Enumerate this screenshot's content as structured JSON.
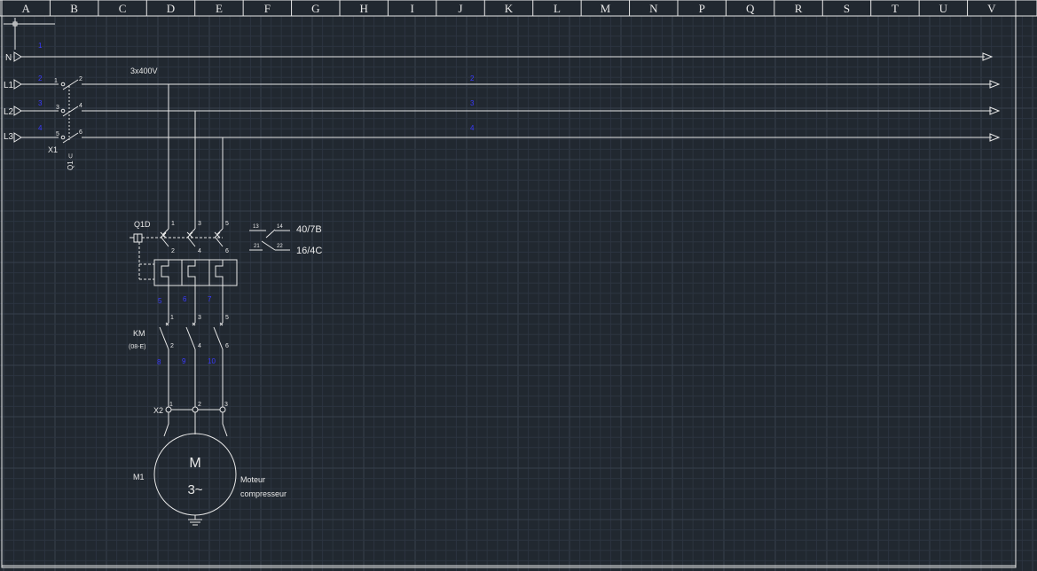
{
  "grid": {
    "columns": [
      "A",
      "B",
      "C",
      "D",
      "E",
      "F",
      "G",
      "H",
      "I",
      "J",
      "K",
      "L",
      "M",
      "N",
      "P",
      "Q",
      "R",
      "S",
      "T",
      "U",
      "V"
    ]
  },
  "colors": {
    "background": "#212830",
    "grid_minor": "#2c3440",
    "grid_major": "#36404c",
    "line": "#e8e8e8",
    "wire_number": "#3a3aff"
  },
  "supply": {
    "voltage_label": "3x400V",
    "rails": [
      {
        "label": "N",
        "num_left": "1",
        "num_mid": ""
      },
      {
        "label": "L1",
        "num_left": "2",
        "num_mid": "2"
      },
      {
        "label": "L2",
        "num_left": "3",
        "num_mid": "3"
      },
      {
        "label": "L3",
        "num_left": "4",
        "num_mid": "4"
      }
    ]
  },
  "main_switch": {
    "name": "X1",
    "label": "Q1 ⊂",
    "terminals": [
      "1",
      "2",
      "3",
      "4",
      "5",
      "6"
    ]
  },
  "breaker": {
    "name": "Q1D",
    "top_terminals": [
      "1",
      "3",
      "5"
    ],
    "bottom_terminals": [
      "2",
      "4",
      "6"
    ],
    "aux_contacts": [
      {
        "left": "13",
        "right": "14",
        "ref": "40/7B"
      },
      {
        "left": "21",
        "right": "22",
        "ref": "16/4C"
      }
    ],
    "wire_numbers": [
      "5",
      "6",
      "7"
    ]
  },
  "contactor": {
    "name": "KM",
    "ref": "(08-E)",
    "top_terminals": [
      "1",
      "3",
      "5"
    ],
    "bottom_terminals": [
      "2",
      "4",
      "6"
    ],
    "wire_numbers": [
      "8",
      "9",
      "10"
    ]
  },
  "terminal_block": {
    "name": "X2",
    "terminals": [
      "1",
      "2",
      "3"
    ]
  },
  "motor": {
    "name": "M1",
    "symbol_top": "M",
    "symbol_bottom": "3~",
    "description_line1": "Moteur",
    "description_line2": "compresseur"
  }
}
